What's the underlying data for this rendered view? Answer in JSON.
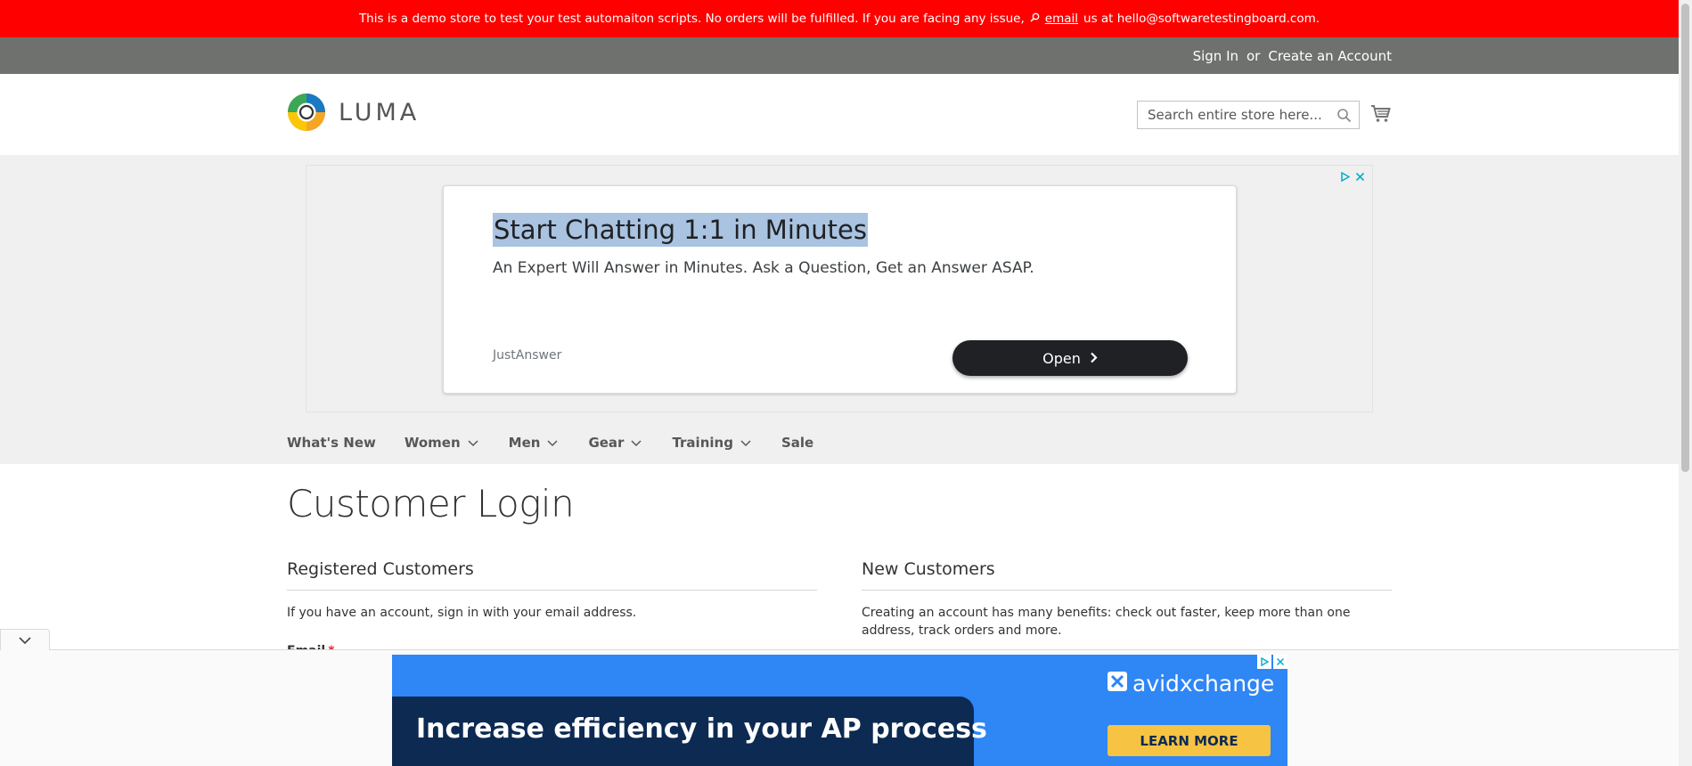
{
  "notice": {
    "text_before": "This is a demo store to test your test automaiton scripts. No orders will be fulfilled. If you are facing any issue,",
    "link": "email",
    "text_after": "us at hello@softwaretestingboard.com."
  },
  "header": {
    "sign_in": "Sign In",
    "or": "or",
    "create_account": "Create an Account"
  },
  "logo": {
    "text": "LUMA"
  },
  "search": {
    "placeholder": "Search entire store here..."
  },
  "ad": {
    "title": "Start Chatting 1:1 in Minutes",
    "description": "An Expert Will Answer in Minutes. Ask a Question, Get an Answer ASAP.",
    "brand": "JustAnswer",
    "button": "Open"
  },
  "nav": {
    "items": [
      {
        "label": "What's New"
      },
      {
        "label": "Women"
      },
      {
        "label": "Men"
      },
      {
        "label": "Gear"
      },
      {
        "label": "Training"
      },
      {
        "label": "Sale"
      }
    ]
  },
  "page": {
    "title": "Customer Login"
  },
  "registered": {
    "title": "Registered Customers",
    "text": "If you have an account, sign in with your email address.",
    "email_label": "Email",
    "required_mark": "*"
  },
  "new_customers": {
    "title": "New Customers",
    "text": "Creating an account has many benefits: check out faster, keep more than one address, track orders and more."
  },
  "bottom_ad": {
    "headline": "Increase efficiency in your AP process",
    "brand": "avidxchange",
    "button": "LEARN MORE"
  },
  "colors": {
    "notice_bg": "#ff0000",
    "header_bg": "#6e716e",
    "band_bg": "#f0f0f0",
    "ad_blue": "#2f86f5",
    "ad_navy": "#0c2a52",
    "ad_yellow": "#f6c343"
  }
}
